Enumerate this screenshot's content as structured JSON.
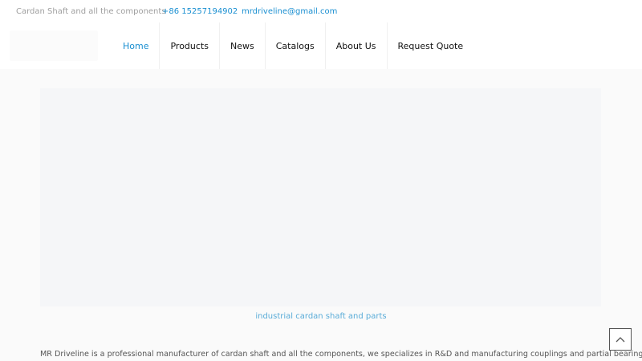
{
  "topbar": {
    "tagline": "Cardan Shaft and all the components",
    "phone": "+86 15257194902",
    "email": "mrdriveline@gmail.com"
  },
  "nav": {
    "items": [
      {
        "label": "Home",
        "active": true
      },
      {
        "label": "Products"
      },
      {
        "label": "News"
      },
      {
        "label": "Catalogs"
      },
      {
        "label": "About Us"
      },
      {
        "label": "Request Quote"
      }
    ]
  },
  "hero": {
    "caption": "industrial cardan shaft and parts"
  },
  "intro": {
    "text": "MR Driveline is a professional manufacturer of cardan shaft and all the components, we specializes in R&D and manufacturing couplings and partial bearings."
  },
  "colors": {
    "accent": "#1a8fd1",
    "caption": "#5aacd8"
  },
  "icons": {
    "back_to_top": "chevron-up-icon"
  }
}
